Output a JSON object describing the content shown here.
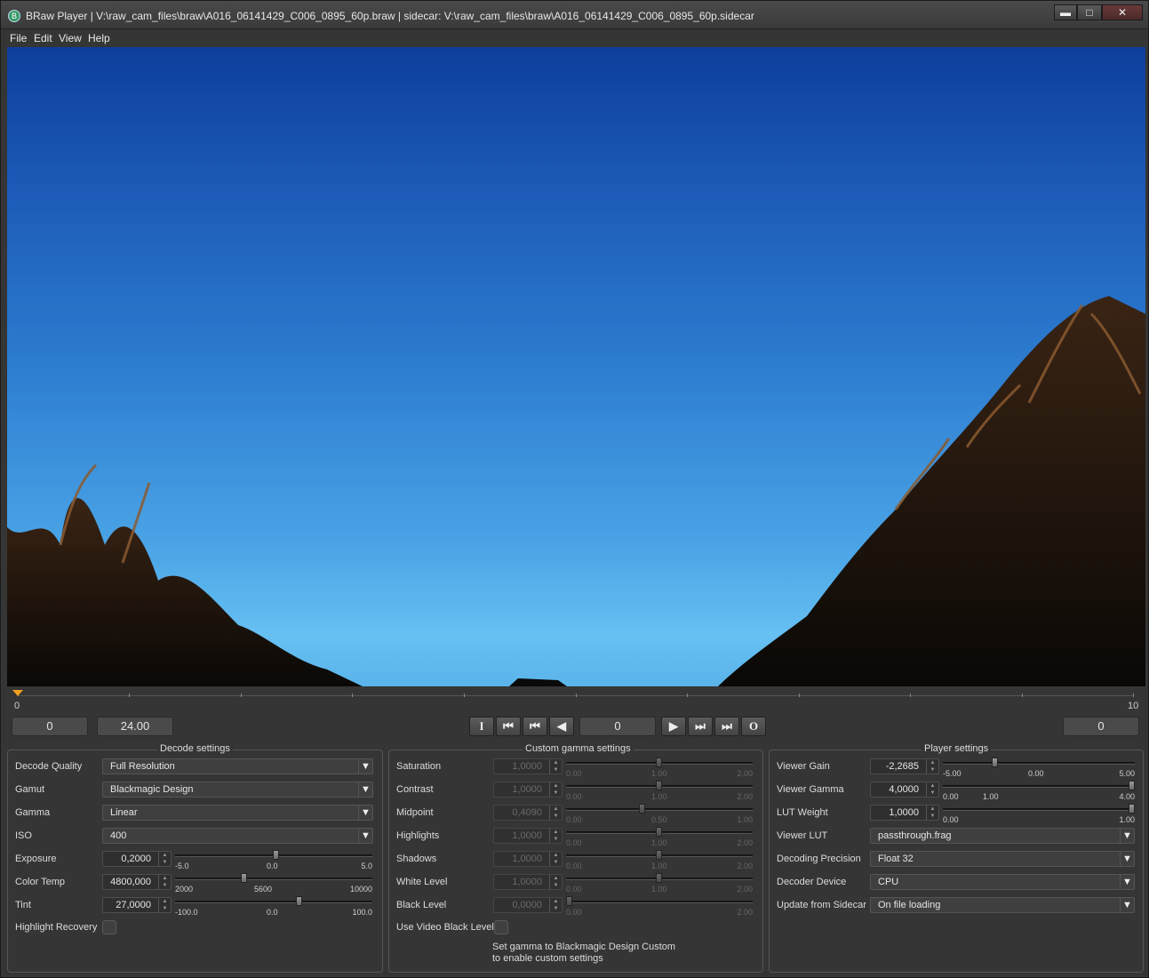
{
  "window": {
    "title": "BRaw Player | V:\\raw_cam_files\\braw\\A016_06141429_C006_0895_60p.braw | sidecar: V:\\raw_cam_files\\braw\\A016_06141429_C006_0895_60p.sidecar",
    "controls": {
      "minimize": "▬",
      "maximize": "□",
      "close": "✕"
    }
  },
  "menu": [
    "File",
    "Edit",
    "View",
    "Help"
  ],
  "timeline": {
    "start_label": "0",
    "end_label": "10",
    "playhead_frame": 0
  },
  "transport": {
    "in_frame": "0",
    "fps": "24.00",
    "current_frame": "0",
    "out_frame": "0",
    "buttons": {
      "mark_in": "I",
      "go_start": "⏮",
      "step_back": "⏮",
      "play_reverse": "◀",
      "play": "▶",
      "step_forward": "⏭",
      "go_end": "⏭",
      "mark_out": "O"
    }
  },
  "decode": {
    "title": "Decode settings",
    "quality": {
      "label": "Decode Quality",
      "value": "Full Resolution"
    },
    "gamut": {
      "label": "Gamut",
      "value": "Blackmagic Design"
    },
    "gamma": {
      "label": "Gamma",
      "value": "Linear"
    },
    "iso": {
      "label": "ISO",
      "value": "400"
    },
    "exposure": {
      "label": "Exposure",
      "value": "0,2000",
      "min": "-5.0",
      "mid": "0.0",
      "max": "5.0"
    },
    "color_temp": {
      "label": "Color Temp",
      "value": "4800,000",
      "min": "2000",
      "mid": "5600",
      "max": "10000"
    },
    "tint": {
      "label": "Tint",
      "value": "27,0000",
      "min": "-100.0",
      "mid": "0.0",
      "max": "100.0"
    },
    "highlight_recovery": {
      "label": "Highlight Recovery",
      "checked": false
    }
  },
  "custom_gamma": {
    "title": "Custom gamma settings",
    "saturation": {
      "label": "Saturation",
      "value": "1,0000",
      "min": "0.00",
      "mid": "1.00",
      "max": "2.00"
    },
    "contrast": {
      "label": "Contrast",
      "value": "1,0000",
      "min": "0.00",
      "mid": "1.00",
      "max": "2.00"
    },
    "midpoint": {
      "label": "Midpoint",
      "value": "0,4090",
      "min": "0.00",
      "mid": "0.50",
      "max": "1.00"
    },
    "highlights": {
      "label": "Highlights",
      "value": "1,0000",
      "min": "0.00",
      "mid": "1.00",
      "max": "2.00"
    },
    "shadows": {
      "label": "Shadows",
      "value": "1,0000",
      "min": "0.00",
      "mid": "1.00",
      "max": "2.00"
    },
    "white_level": {
      "label": "White Level",
      "value": "1,0000",
      "min": "0.00",
      "mid": "1.00",
      "max": "2.00"
    },
    "black_level": {
      "label": "Black Level",
      "value": "0,0000",
      "min": "0.00",
      "max": "2.00"
    },
    "use_video_black": {
      "label": "Use Video Black Level",
      "checked": false
    },
    "note_line1": "Set gamma to Blackmagic Design Custom",
    "note_line2": "to enable custom settings"
  },
  "player": {
    "title": "Player settings",
    "viewer_gain": {
      "label": "Viewer Gain",
      "value": "-2,2685",
      "min": "-5.00",
      "mid": "0.00",
      "max": "5.00"
    },
    "viewer_gamma": {
      "label": "Viewer Gamma",
      "value": "4,0000",
      "min": "0.00",
      "mid": "1.00",
      "max": "4.00"
    },
    "lut_weight": {
      "label": "LUT Weight",
      "value": "1,0000",
      "min": "0.00",
      "max": "1.00"
    },
    "viewer_lut": {
      "label": "Viewer LUT",
      "value": "passthrough.frag"
    },
    "decoding_precision": {
      "label": "Decoding Precision",
      "value": "Float 32"
    },
    "decoder_device": {
      "label": "Decoder Device",
      "value": "CPU"
    },
    "update_from_sidecar": {
      "label": "Update from Sidecar",
      "value": "On file loading"
    }
  },
  "colors": {
    "accent": "#f0a020",
    "panel_bg": "#353535",
    "sky_top": "#0d3e9c",
    "sky_bottom": "#66c0f2"
  }
}
